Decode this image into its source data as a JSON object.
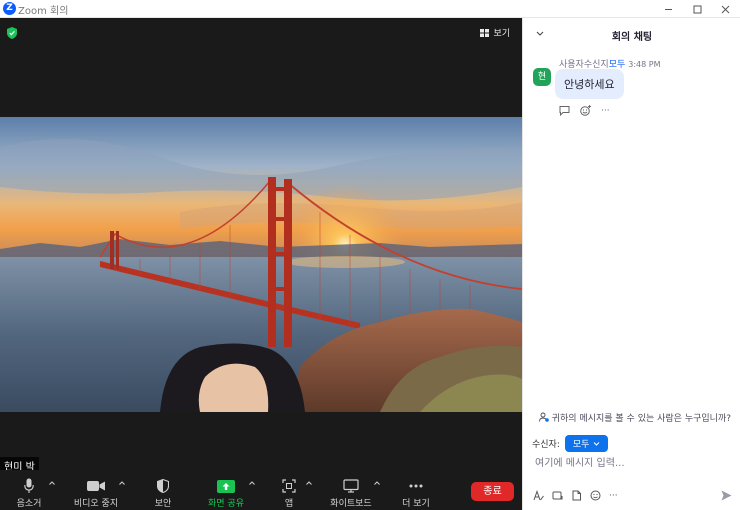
{
  "window": {
    "title": "Zoom 회의",
    "logo_letter": "Z"
  },
  "video": {
    "view_label": "보기",
    "participant_name": "현미 박"
  },
  "toolbar": {
    "mute_label": "음소거",
    "video_label": "비디오 중지",
    "security_label": "보안",
    "share_label": "화면 공유",
    "apps_label": "앱",
    "whiteboard_label": "화이트보드",
    "more_label": "더 보기",
    "end_label": "종료",
    "share_color": "#1ac252",
    "end_color": "#e02828"
  },
  "chat": {
    "title": "회의 채팅",
    "message": {
      "avatar_letter": "현",
      "sender_prefix": "사용자수신지",
      "recipient": "모두",
      "time": "3:48 PM",
      "text": "안녕하세요",
      "more_dots": "···"
    },
    "who_can_see": "귀하의 메시지를 볼 수 있는 사람은 누구입니까?",
    "recipient_label": "수신자:",
    "recipient_value": "모두",
    "input_placeholder": "여기에 메시지 입력...",
    "tools_more": "···",
    "accent_color": "#0e72ed"
  }
}
